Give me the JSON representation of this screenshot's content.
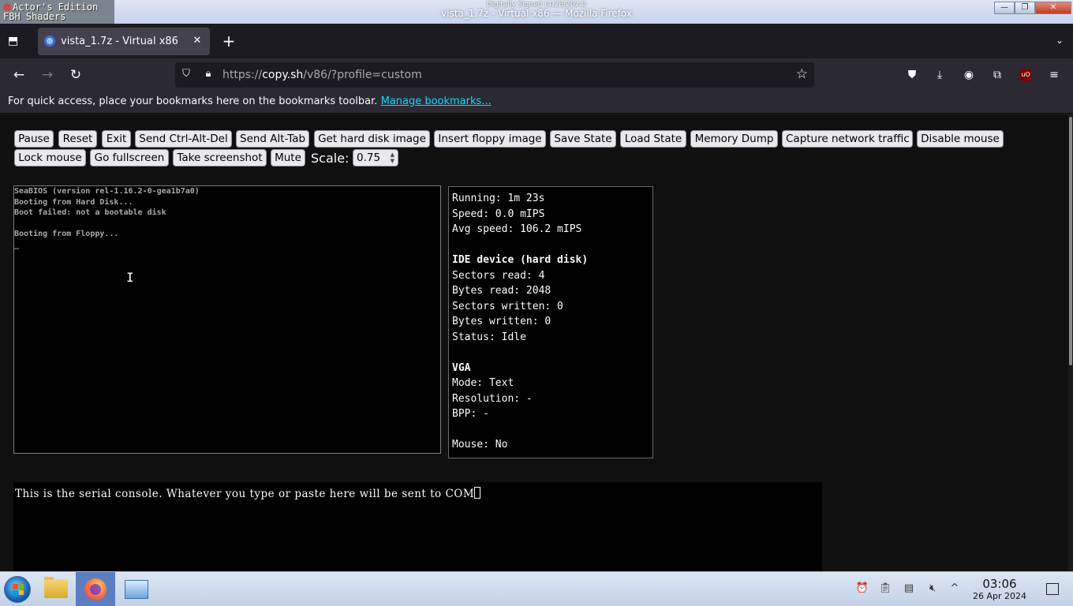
{
  "window": {
    "badge_line1": "Actor's Edition",
    "badge_line2": "FBH Shaders",
    "signed": "Digitally Signed (4/28/2024)",
    "title": "vista_1.7z - Virtual x86 — Mozilla Firefox",
    "min": "—",
    "max": "❐",
    "close": "✕"
  },
  "tab": {
    "label": "vista_1.7z - Virtual x86",
    "close": "✕",
    "new": "+",
    "list_all": "⬒",
    "menu": "⌄"
  },
  "nav": {
    "back": "←",
    "forward": "→",
    "reload": "↻",
    "url_prefix": "https://",
    "url_host": "copy.sh",
    "url_path": "/v86/?profile=custom",
    "star": "☆",
    "menu": "≡"
  },
  "bookmarks": {
    "text": "For quick access, place your bookmarks here on the bookmarks toolbar.",
    "link": "Manage bookmarks..."
  },
  "toolbar": {
    "pause": "Pause",
    "reset": "Reset",
    "exit": "Exit",
    "ctrl_alt_del": "Send Ctrl-Alt-Del",
    "alt_tab": "Send Alt-Tab",
    "hard_disk_image": "Get hard disk image",
    "floppy_image": "Insert floppy image",
    "save_state": "Save State",
    "load_state": "Load State",
    "memory_dump": "Memory Dump",
    "capture_network": "Capture network traffic",
    "disable_mouse": "Disable mouse",
    "lock_mouse": "Lock mouse",
    "fullscreen": "Go fullscreen",
    "screenshot": "Take screenshot",
    "mute": "Mute",
    "scale_label": "Scale:",
    "scale_value": "0.75"
  },
  "screen": {
    "lines": [
      "SeaBIOS (version rel-1.16.2-0-gea1b7a0)",
      "Booting from Hard Disk...",
      "Boot failed: not a bootable disk",
      "",
      "Booting from Floppy...",
      "_"
    ]
  },
  "stats": {
    "running": "Running: 1m 23s",
    "speed": "Speed: 0.0 mIPS",
    "avg_speed": "Avg speed: 106.2 mIPS",
    "ide_header": "IDE device (hard disk)",
    "sectors_read": "Sectors read: 4",
    "bytes_read": "Bytes read: 2048",
    "sectors_written": "Sectors written: 0",
    "bytes_written": "Bytes written: 0",
    "status": "Status: Idle",
    "vga_header": "VGA",
    "mode": "Mode: Text",
    "resolution": "Resolution: -",
    "bpp": "BPP: -",
    "mouse": "Mouse: No"
  },
  "serial": {
    "text": "This is the serial console. Whatever you type or paste here will be sent to COM"
  },
  "taskbar": {
    "time": "03:06",
    "date": "26 Apr 2024"
  },
  "colors": {
    "link": "#00ddff",
    "content_bg": "#101010",
    "button_bg": "#e9e9ed"
  }
}
